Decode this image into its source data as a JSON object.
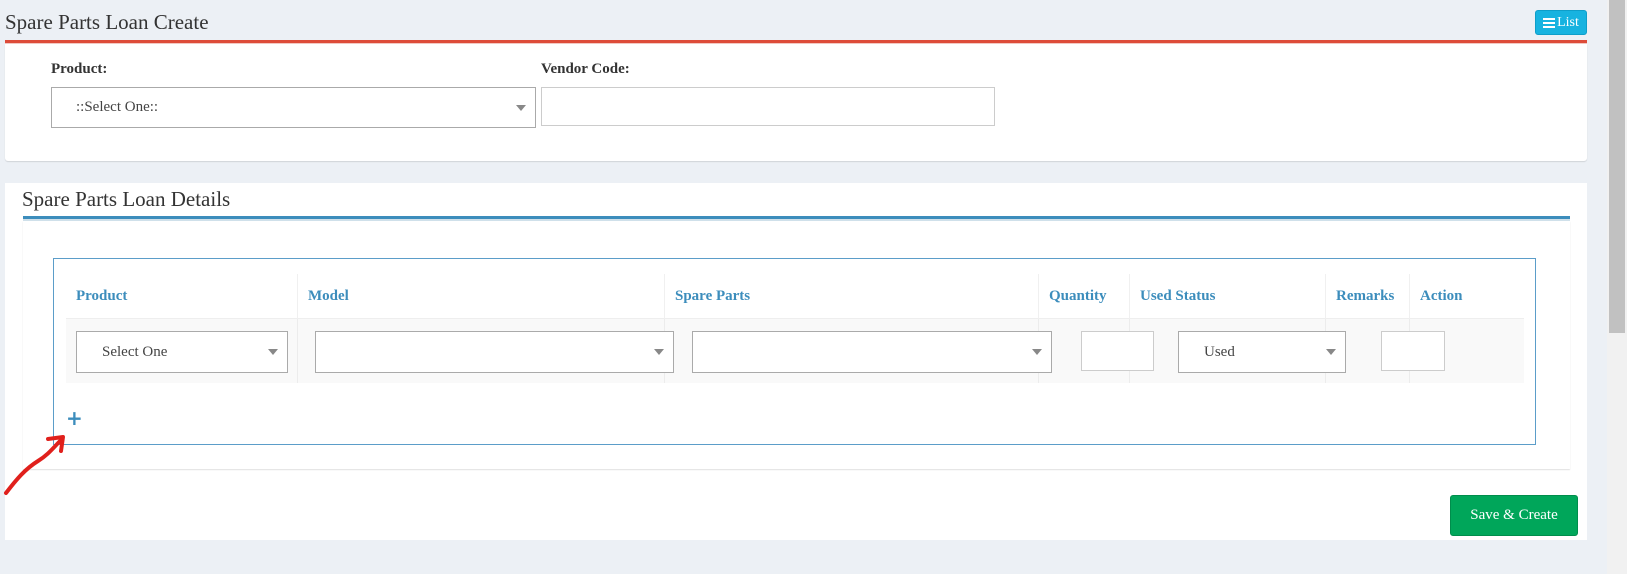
{
  "header": {
    "title": "Spare Parts Loan Create",
    "list_button_label": "List"
  },
  "top_form": {
    "product_label": "Product:",
    "product_value": "::Select One::",
    "vendor_code_label": "Vendor Code:",
    "vendor_code_value": ""
  },
  "details": {
    "title": "Spare Parts Loan Details",
    "columns": [
      "Product",
      "Model",
      "Spare Parts",
      "Quantity",
      "Used Status",
      "Remarks",
      "Action"
    ],
    "row": {
      "product": "Select One",
      "model": "",
      "spare_parts": "",
      "quantity": "",
      "used_status": "Used",
      "remarks": ""
    },
    "add_row_symbol": "+"
  },
  "actions": {
    "save_label": "Save & Create"
  },
  "colors": {
    "header_accent": "#dd4b39",
    "details_accent": "#3c8dbc",
    "list_button": "#17b3e0",
    "save_button": "#00a65a",
    "annotation_arrow": "#e0201c"
  }
}
